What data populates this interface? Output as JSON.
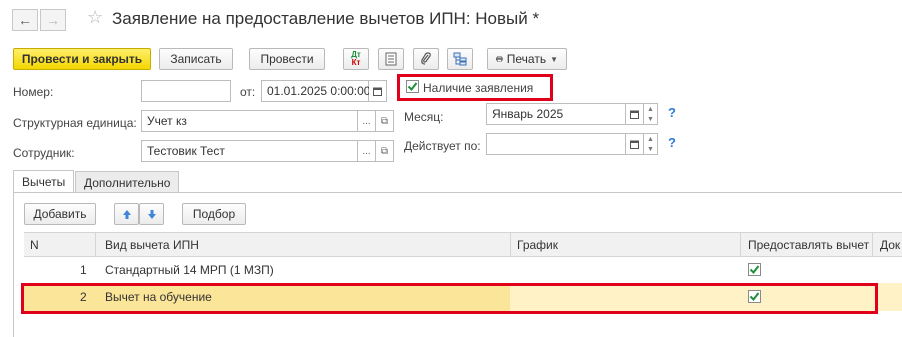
{
  "header": {
    "back_icon": "arrow-left-icon",
    "forward_icon": "arrow-right-icon",
    "title": "Заявление на предоставление вычетов ИПН: Новый *"
  },
  "toolbar": {
    "post_close_label": "Провести и закрыть",
    "save_label": "Записать",
    "post_label": "Провести",
    "print_label": "Печать"
  },
  "form": {
    "number_label": "Номер:",
    "number_value": "",
    "from_label": "от:",
    "date_value": "01.01.2025  0:00:00",
    "application_label": "Наличие заявления",
    "application_checked": true,
    "unit_label": "Структурная единица:",
    "unit_value": "Учет кз",
    "month_label": "Месяц:",
    "month_value": "Январь 2025",
    "employee_label": "Сотрудник:",
    "employee_value": "Тестовик Тест",
    "valid_label": "Действует по:",
    "valid_value": "",
    "help_mark": "?"
  },
  "tabs": [
    {
      "label": "Вычеты"
    },
    {
      "label": "Дополнительно"
    }
  ],
  "table_toolbar": {
    "add_label": "Добавить",
    "select_label": "Подбор"
  },
  "table": {
    "columns": [
      "N",
      "Вид вычета ИПН",
      "График",
      "Предоставлять вычет",
      "Док"
    ],
    "rows": [
      {
        "n": "1",
        "type": "Стандартный 14 МРП (1 МЗП)",
        "schedule": "",
        "provide": true
      },
      {
        "n": "2",
        "type": "Вычет на обучение",
        "schedule": "",
        "provide": true
      }
    ]
  },
  "colors": {
    "primary_button": "#f3d600",
    "highlight": "#e0001b",
    "selected_row": "#fbe598",
    "check": "#1e8f3a"
  }
}
